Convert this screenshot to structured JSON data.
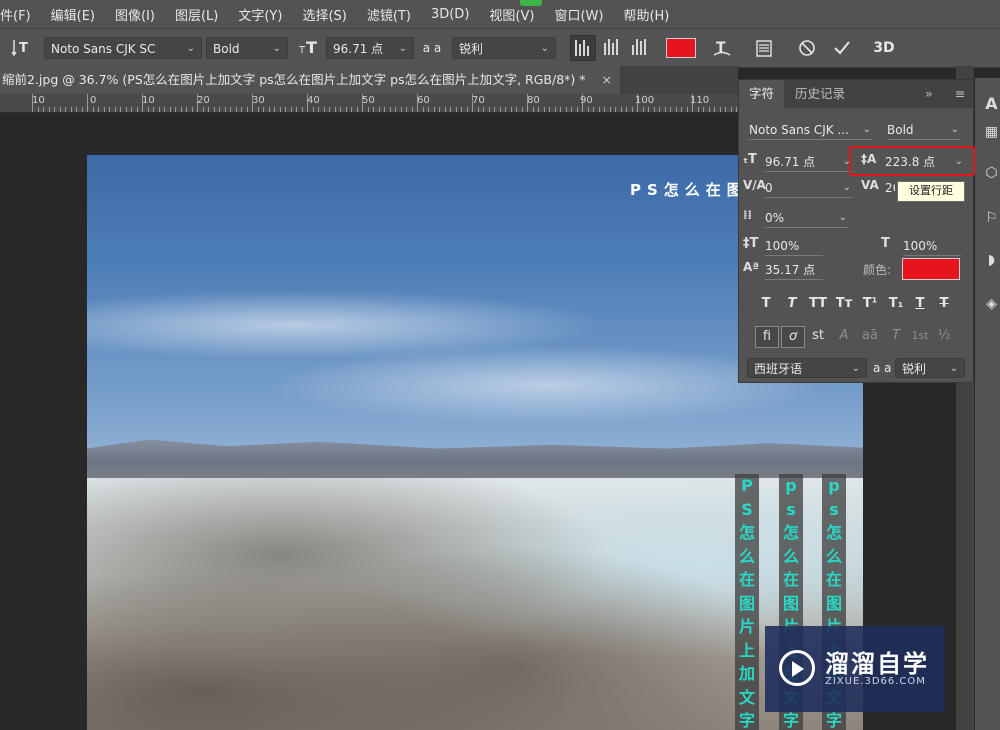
{
  "menu": [
    "件(F)",
    "编辑(E)",
    "图像(I)",
    "图层(L)",
    "文字(Y)",
    "选择(S)",
    "滤镜(T)",
    "3D(D)",
    "视图(V)",
    "窗口(W)",
    "帮助(H)"
  ],
  "options_bar": {
    "font_family": "Noto Sans CJK SC",
    "font_style": "Bold",
    "font_size": "96.71 点",
    "antialias_label": "a a",
    "antialias": "锐利",
    "text_color": "#e8141d",
    "threed_label": "3D"
  },
  "document_tab": {
    "title": "缩前2.jpg @ 36.7% (PS怎么在图片上加文字 ps怎么在图片上加文字 ps怎么在图片上加文字, RGB/8*) *",
    "close": "×"
  },
  "ruler": {
    "labels": [
      "10",
      "0",
      "10",
      "20",
      "30",
      "40",
      "50",
      "60",
      "70",
      "80",
      "90",
      "100",
      "110"
    ]
  },
  "canvas": {
    "top_text": "PS怎么在图",
    "vertical_columns": [
      [
        "P",
        "S",
        "怎",
        "么",
        "在",
        "图",
        "片",
        "上",
        "加",
        "文",
        "字"
      ],
      [
        "p",
        "s",
        "怎",
        "么",
        "在",
        "图",
        "片",
        "上",
        "加",
        "文",
        "字"
      ],
      [
        "p",
        "s",
        "怎",
        "么",
        "在",
        "图",
        "片",
        "上",
        "加",
        "文",
        "字"
      ]
    ],
    "vertical_text_color": "#29d9c8"
  },
  "character_panel": {
    "tabs": [
      "字符",
      "历史记录"
    ],
    "collapse": "»",
    "menu": "≡",
    "font_family": "Noto Sans CJK ...",
    "font_style": "Bold",
    "size": "96.71 点",
    "leading": "223.8 点",
    "kerning": "0",
    "tracking": "26",
    "tsume": "0%",
    "vertical_scale": "100%",
    "horizontal_scale": "100%",
    "baseline_shift": "35.17 点",
    "color_label": "颜色:",
    "color": "#e8141d",
    "style_buttons": [
      "T",
      "T",
      "TT",
      "Tт",
      "T¹",
      "T₁",
      "T",
      "T"
    ],
    "opentype_buttons": [
      "ﬁ",
      "ơ",
      "st",
      "A",
      "aā",
      "T",
      "1st",
      "½"
    ],
    "language": "西班牙语",
    "antialias_label": "a a",
    "antialias": "锐利",
    "tooltip": "设置行距"
  },
  "watermark": {
    "title": "溜溜自学",
    "url": "ZIXUE.3D66.COM"
  }
}
